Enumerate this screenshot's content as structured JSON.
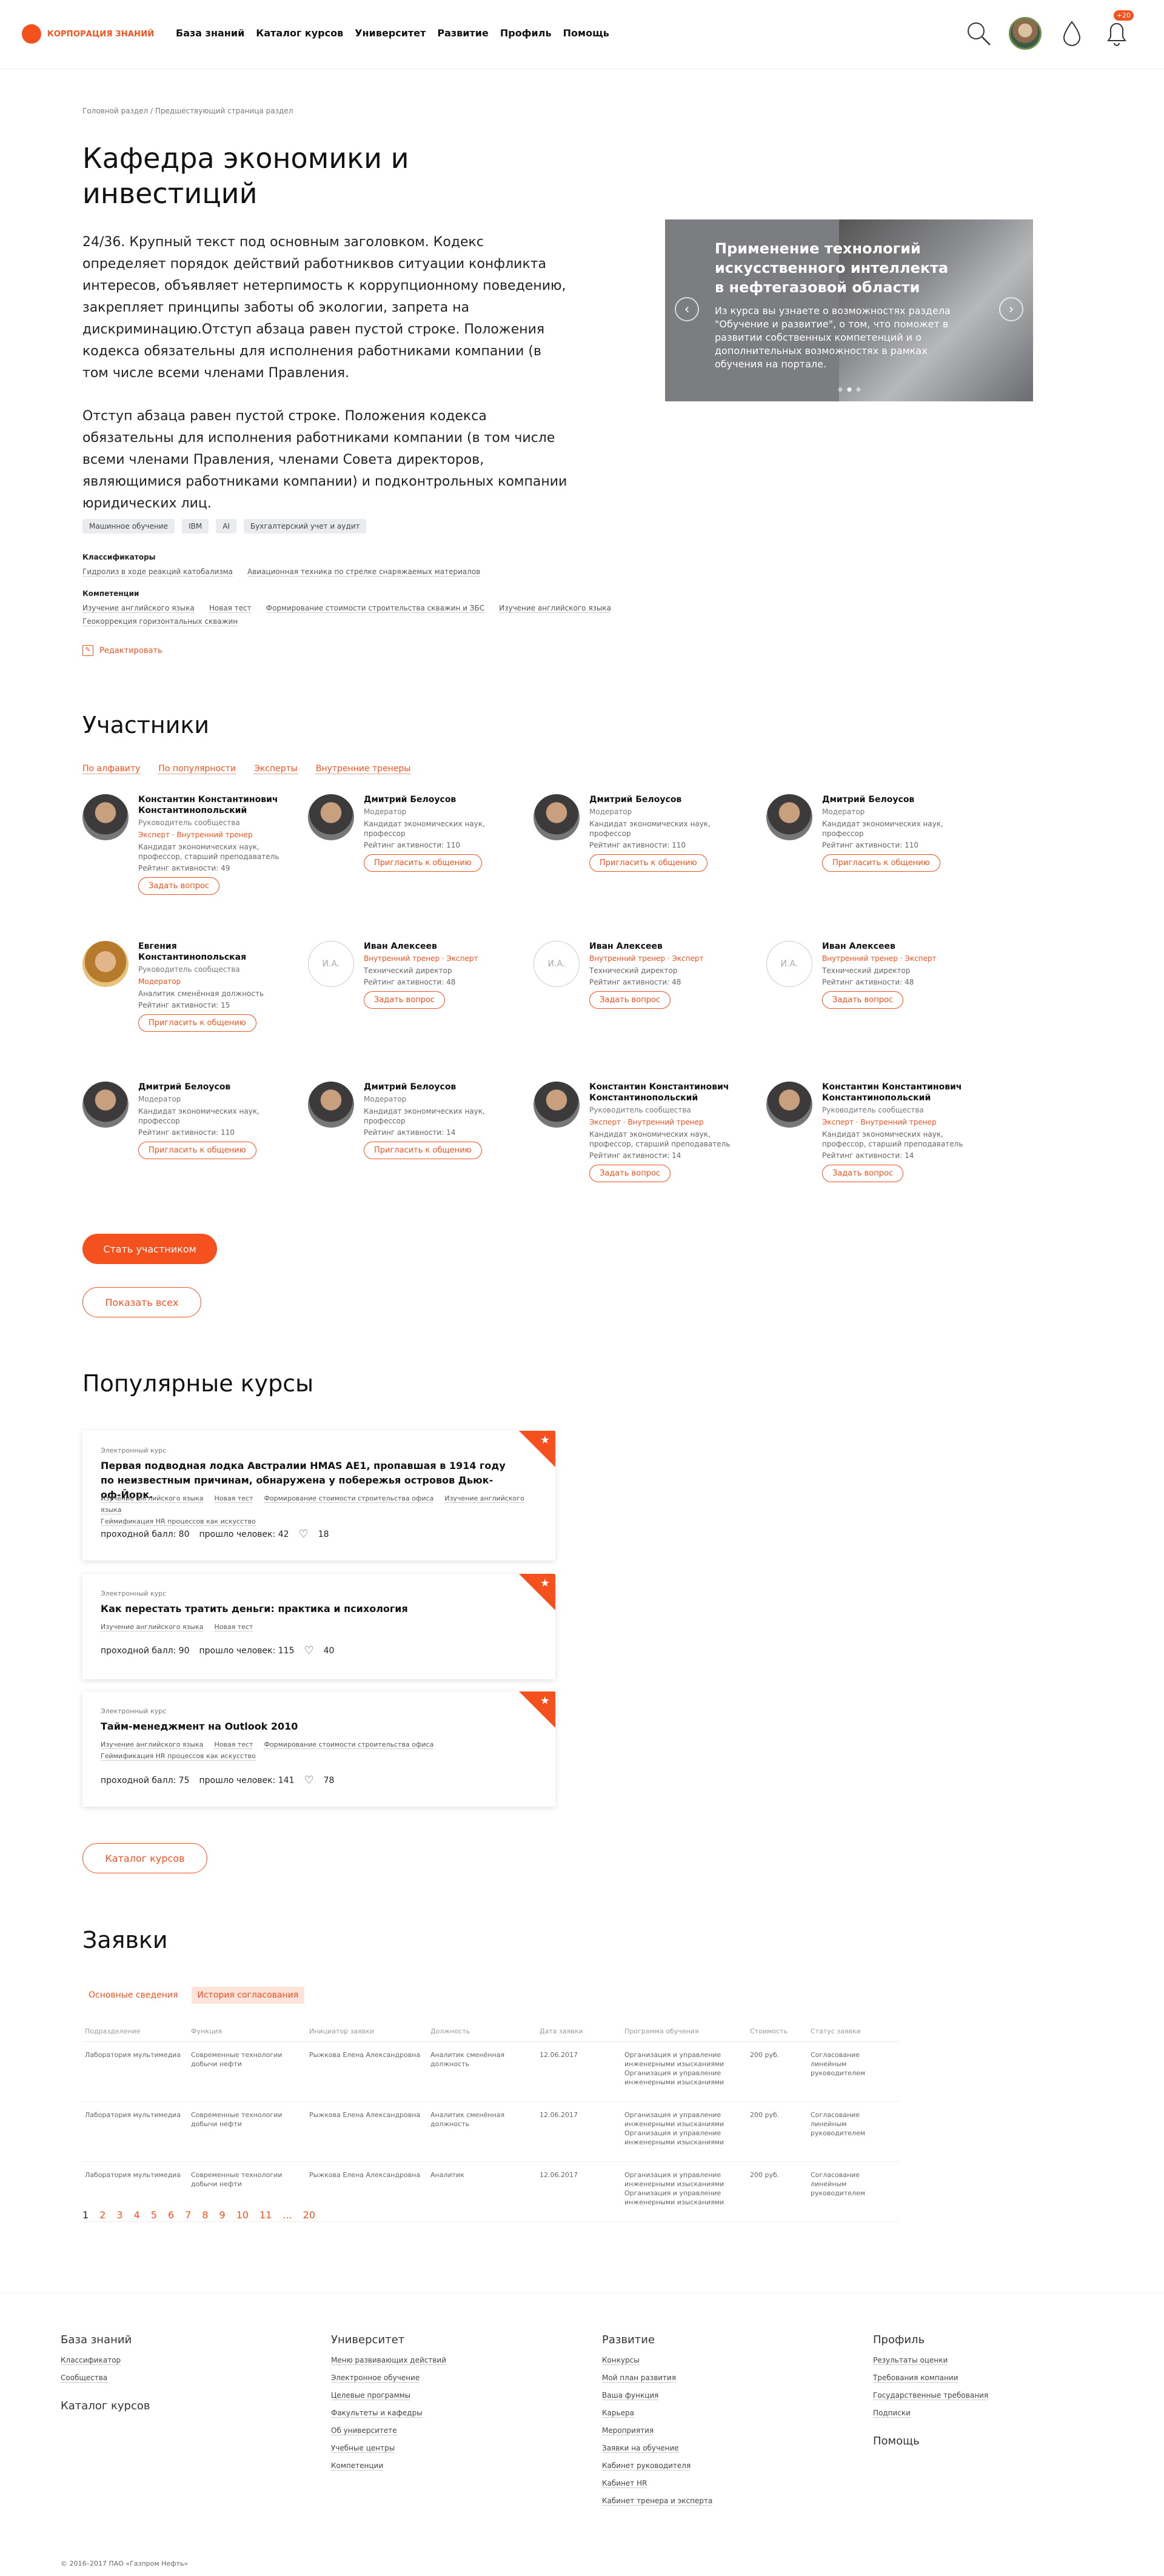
{
  "header": {
    "logo": "КОРПОРАЦИЯ ЗНАНИЙ",
    "nav": [
      "База знаний",
      "Каталог курсов",
      "Университет",
      "Развитие",
      "Профиль",
      "Помощь"
    ],
    "badge": "+20"
  },
  "breadcrumb": "Головной раздел / Предшествующий страница раздел",
  "title": "Кафедра экономики и инвестиций",
  "lead": "24/36. Крупный текст под основным заголовком. Кодекс определяет порядок действий работниквов ситуации конфликта интересов, объявляет нетерпимость к коррупционному поведению, закрепляет принципы заботы об экологии, запрета на дискриминацию.Отступ абзаца равен пустой строке. Положения кодекса обязательны для исполнения работниками компании (в том числе всеми членами Правления.",
  "lead2": "Отступ абзаца равен пустой строке. Положения кодекса обязательны для исполнения работниками компании (в том числе всеми членами Правления, членами Совета директоров, являющимися работниками компании) и подконтрольных компании юридических лиц.",
  "hero": {
    "title": "Применение технологий искусственного интеллекта в нефтегазовой области",
    "text": "Из курса вы узнаете о возможностях раздела \"Обучение и развитие\", о том, что поможет в развитии собственных компетенций и о дополнительных возможностях в рамках обучения на портале."
  },
  "tags": [
    "Машинное обучение",
    "IBM",
    "AI",
    "Бухгалтерский учет и аудит"
  ],
  "classifiers": {
    "title": "Классификаторы",
    "items": [
      "Гидролиз в ходе реакций катобализма",
      "Авиационная техника по стрелке снаряжаемых материалов"
    ]
  },
  "competencies": {
    "title": "Компетенции",
    "items": [
      "Изучение английского языка",
      "Новая тест",
      "Формирование стоимости строительства скважин и ЗБС",
      "Изучение английского языка",
      "Геокоррекция горизонтальных скважин"
    ]
  },
  "edit": "Редактировать",
  "participants": {
    "title": "Участники",
    "filters": [
      "По алфавиту",
      "По популярности",
      "Эксперты",
      "Внутренние тренеры"
    ],
    "rows": [
      [
        {
          "name": "Константин Константинович Константинопольский",
          "role1": "Руководитель сообщества",
          "role2": "Эксперт · Внутренний тренер",
          "desc": "Кандидат экономических наук, профессор, старший преподаватель",
          "rating": "Рейтинг активности: 49",
          "btn": "Задать вопрос",
          "av": "man"
        },
        {
          "name": "Дмитрий Белоусов",
          "role1": "Модератор",
          "role2": "",
          "desc": "Кандидат экономических наук, профессор",
          "rating": "Рейтинг активности: 110",
          "btn": "Пригласить к общению",
          "av": "man"
        },
        {
          "name": "Дмитрий Белоусов",
          "role1": "Модератор",
          "role2": "",
          "desc": "Кандидат экономических наук, профессор",
          "rating": "Рейтинг активности: 110",
          "btn": "Пригласить к общению",
          "av": "man"
        },
        {
          "name": "Дмитрий Белоусов",
          "role1": "Модератор",
          "role2": "",
          "desc": "Кандидат экономических наук, профессор",
          "rating": "Рейтинг активности: 110",
          "btn": "Пригласить к общению",
          "av": "man"
        }
      ],
      [
        {
          "name": "Евгения Константинопольская",
          "role1": "Руководитель сообщества",
          "role2": "Модератор",
          "desc": "Аналитик сменённая должность",
          "rating": "Рейтинг активности: 15",
          "btn": "Пригласить к общению",
          "av": "woman"
        },
        {
          "name": "Иван Алексеев",
          "role1": "Внутренний тренер · Эксперт",
          "role2": "",
          "desc": "Технический директор",
          "rating": "Рейтинг активности: 48",
          "btn": "Задать вопрос",
          "av": "empty",
          "ini": "И.А."
        },
        {
          "name": "Иван Алексеев",
          "role1": "Внутренний тренер · Эксперт",
          "role2": "",
          "desc": "Технический директор",
          "rating": "Рейтинг активности: 48",
          "btn": "Задать вопрос",
          "av": "empty",
          "ini": "И.А."
        },
        {
          "name": "Иван Алексеев",
          "role1": "Внутренний тренер · Эксперт",
          "role2": "",
          "desc": "Технический директор",
          "rating": "Рейтинг активности: 48",
          "btn": "Задать вопрос",
          "av": "empty",
          "ini": "И.А."
        }
      ],
      [
        {
          "name": "Дмитрий Белоусов",
          "role1": "Модератор",
          "role2": "",
          "desc": "Кандидат экономических наук, профессор",
          "rating": "Рейтинг активности: 110",
          "btn": "Пригласить к общению",
          "av": "man"
        },
        {
          "name": "Дмитрий Белоусов",
          "role1": "Модератор",
          "role2": "",
          "desc": "Кандидат экономических наук, профессор",
          "rating": "Рейтинг активности: 14",
          "btn": "Пригласить к общению",
          "av": "man"
        },
        {
          "name": "Константин Константинович Константинопольский",
          "role1": "Руководитель сообщества",
          "role2": "Эксперт · Внутренний тренер",
          "desc": "Кандидат экономических наук, профессор, старший преподаватель",
          "rating": "Рейтинг активности: 14",
          "btn": "Задать вопрос",
          "av": "man"
        },
        {
          "name": "Константин Константинович Константинопольский",
          "role1": "Руководитель сообщества",
          "role2": "Эксперт · Внутренний тренер",
          "desc": "Кандидат экономических наук, профессор, старший преподаватель",
          "rating": "Рейтинг активности: 14",
          "btn": "Задать вопрос",
          "av": "man"
        }
      ]
    ],
    "join": "Стать участником",
    "show_all": "Показать всех"
  },
  "courses": {
    "title": "Популярные курсы",
    "items": [
      {
        "kind": "Электронный курс",
        "title": "Первая подводная лодка Австралии HMAS AE1, пропавшая в 1914 году по неизвестным причинам, обнаружена у побережья островов Дьюк-оф-Йорк.",
        "tags": [
          "Изучение английского языка",
          "Новая тест",
          "Формирование стоимости строительства офиса",
          "Изучение английского языка",
          "Геймификация HR процессов как искусство"
        ],
        "score": "проходной балл: 80",
        "passed": "прошло человек: 42",
        "likes": "18"
      },
      {
        "kind": "Электронный курс",
        "title": "Как перестать тратить деньги: практика и психология",
        "tags": [
          "Изучение английского языка",
          "Новая тест"
        ],
        "score": "проходной балл: 90",
        "passed": "прошло человек: 115",
        "likes": "40"
      },
      {
        "kind": "Электронный курс",
        "title": "Тайм-менеджмент на Outlook 2010",
        "tags": [
          "Изучение английского языка",
          "Новая тест",
          "Формирование стоимости строительства офиса",
          "Геймификация HR процессов как искусство"
        ],
        "score": "проходной балл: 75",
        "passed": "прошло человек: 141",
        "likes": "78"
      }
    ],
    "catalog": "Каталог курсов"
  },
  "apps": {
    "title": "Заявки",
    "tabs": [
      "Основные сведения",
      "История согласования"
    ],
    "cols": [
      "Подразделение",
      "Функция",
      "Инициатор заявки",
      "Должность",
      "Дата заявки",
      "Программа обучения",
      "Стоимость",
      "Статус заявки"
    ],
    "rows": [
      [
        "Лаборатория мультимедиа",
        "Современные технологии добычи нефти",
        "Рыжкова Елена Александровна",
        "Аналитик сменённая должность",
        "12.06.2017",
        "Организация и управление инженерными изысканиями Организация и управление инженерными изысканиями",
        "200 руб.",
        "Согласование линейным руководителем"
      ],
      [
        "Лаборатория мультимедиа",
        "Современные технологии добычи нефти",
        "Рыжкова Елена Александровна",
        "Аналитик сменённая должность",
        "12.06.2017",
        "Организация и управление инженерными изысканиями Организация и управление инженерными изысканиями",
        "200 руб.",
        "Согласование линейным руководителем"
      ],
      [
        "Лаборатория мультимедиа",
        "Современные технологии добычи нефти",
        "Рыжкова Елена Александровна",
        "Аналитик",
        "12.06.2017",
        "Организация и управление инженерными изысканиями Организация и управление инженерными изысканиями",
        "200 руб.",
        "Согласование линейным руководителем"
      ]
    ],
    "pages": [
      "1",
      "2",
      "3",
      "4",
      "5",
      "6",
      "7",
      "8",
      "9",
      "10",
      "11",
      "...",
      "20"
    ]
  },
  "footer": {
    "cols": [
      {
        "title": "База знаний",
        "links": [
          "Классификатор",
          "Сообщества"
        ],
        "title2": "Каталог курсов"
      },
      {
        "title": "Университет",
        "links": [
          "Меню развивающих действий",
          "Электронное обучение",
          "Целевые программы",
          "Факультеты и кафедры",
          "Об университете",
          "Учебные центры",
          "Компетенции"
        ]
      },
      {
        "title": "Развитие",
        "links": [
          "Конкурсы",
          "Мой план развития",
          "Ваша функция",
          "Карьера",
          "Мероприятия",
          "Заявки на обучение",
          "Кабинет руководителя",
          "Кабинет HR",
          "Кабинет тренера и эксперта"
        ]
      },
      {
        "title": "Профиль",
        "links": [
          "Результаты оценки",
          "Требования компании",
          "Государственные требования",
          "Подписки"
        ],
        "title2": "Помощь"
      }
    ],
    "copy": "© 2016–2017 ПАО «Газпром Нефть»"
  }
}
